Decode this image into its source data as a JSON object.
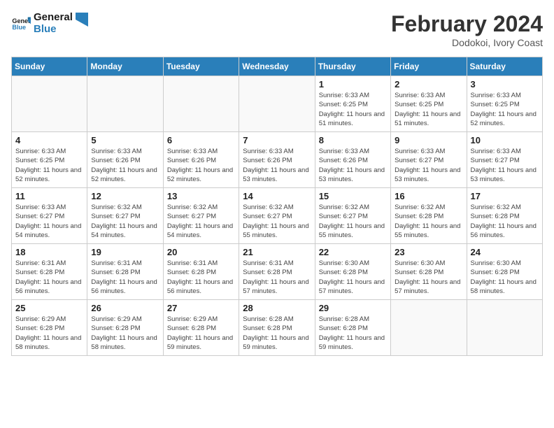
{
  "header": {
    "logo_line1": "General",
    "logo_line2": "Blue",
    "title": "February 2024",
    "subtitle": "Dodokoi, Ivory Coast"
  },
  "weekdays": [
    "Sunday",
    "Monday",
    "Tuesday",
    "Wednesday",
    "Thursday",
    "Friday",
    "Saturday"
  ],
  "weeks": [
    [
      {
        "day": "",
        "info": ""
      },
      {
        "day": "",
        "info": ""
      },
      {
        "day": "",
        "info": ""
      },
      {
        "day": "",
        "info": ""
      },
      {
        "day": "1",
        "info": "Sunrise: 6:33 AM\nSunset: 6:25 PM\nDaylight: 11 hours and 51 minutes."
      },
      {
        "day": "2",
        "info": "Sunrise: 6:33 AM\nSunset: 6:25 PM\nDaylight: 11 hours and 51 minutes."
      },
      {
        "day": "3",
        "info": "Sunrise: 6:33 AM\nSunset: 6:25 PM\nDaylight: 11 hours and 52 minutes."
      }
    ],
    [
      {
        "day": "4",
        "info": "Sunrise: 6:33 AM\nSunset: 6:25 PM\nDaylight: 11 hours and 52 minutes."
      },
      {
        "day": "5",
        "info": "Sunrise: 6:33 AM\nSunset: 6:26 PM\nDaylight: 11 hours and 52 minutes."
      },
      {
        "day": "6",
        "info": "Sunrise: 6:33 AM\nSunset: 6:26 PM\nDaylight: 11 hours and 52 minutes."
      },
      {
        "day": "7",
        "info": "Sunrise: 6:33 AM\nSunset: 6:26 PM\nDaylight: 11 hours and 53 minutes."
      },
      {
        "day": "8",
        "info": "Sunrise: 6:33 AM\nSunset: 6:26 PM\nDaylight: 11 hours and 53 minutes."
      },
      {
        "day": "9",
        "info": "Sunrise: 6:33 AM\nSunset: 6:27 PM\nDaylight: 11 hours and 53 minutes."
      },
      {
        "day": "10",
        "info": "Sunrise: 6:33 AM\nSunset: 6:27 PM\nDaylight: 11 hours and 53 minutes."
      }
    ],
    [
      {
        "day": "11",
        "info": "Sunrise: 6:33 AM\nSunset: 6:27 PM\nDaylight: 11 hours and 54 minutes."
      },
      {
        "day": "12",
        "info": "Sunrise: 6:32 AM\nSunset: 6:27 PM\nDaylight: 11 hours and 54 minutes."
      },
      {
        "day": "13",
        "info": "Sunrise: 6:32 AM\nSunset: 6:27 PM\nDaylight: 11 hours and 54 minutes."
      },
      {
        "day": "14",
        "info": "Sunrise: 6:32 AM\nSunset: 6:27 PM\nDaylight: 11 hours and 55 minutes."
      },
      {
        "day": "15",
        "info": "Sunrise: 6:32 AM\nSunset: 6:27 PM\nDaylight: 11 hours and 55 minutes."
      },
      {
        "day": "16",
        "info": "Sunrise: 6:32 AM\nSunset: 6:28 PM\nDaylight: 11 hours and 55 minutes."
      },
      {
        "day": "17",
        "info": "Sunrise: 6:32 AM\nSunset: 6:28 PM\nDaylight: 11 hours and 56 minutes."
      }
    ],
    [
      {
        "day": "18",
        "info": "Sunrise: 6:31 AM\nSunset: 6:28 PM\nDaylight: 11 hours and 56 minutes."
      },
      {
        "day": "19",
        "info": "Sunrise: 6:31 AM\nSunset: 6:28 PM\nDaylight: 11 hours and 56 minutes."
      },
      {
        "day": "20",
        "info": "Sunrise: 6:31 AM\nSunset: 6:28 PM\nDaylight: 11 hours and 56 minutes."
      },
      {
        "day": "21",
        "info": "Sunrise: 6:31 AM\nSunset: 6:28 PM\nDaylight: 11 hours and 57 minutes."
      },
      {
        "day": "22",
        "info": "Sunrise: 6:30 AM\nSunset: 6:28 PM\nDaylight: 11 hours and 57 minutes."
      },
      {
        "day": "23",
        "info": "Sunrise: 6:30 AM\nSunset: 6:28 PM\nDaylight: 11 hours and 57 minutes."
      },
      {
        "day": "24",
        "info": "Sunrise: 6:30 AM\nSunset: 6:28 PM\nDaylight: 11 hours and 58 minutes."
      }
    ],
    [
      {
        "day": "25",
        "info": "Sunrise: 6:29 AM\nSunset: 6:28 PM\nDaylight: 11 hours and 58 minutes."
      },
      {
        "day": "26",
        "info": "Sunrise: 6:29 AM\nSunset: 6:28 PM\nDaylight: 11 hours and 58 minutes."
      },
      {
        "day": "27",
        "info": "Sunrise: 6:29 AM\nSunset: 6:28 PM\nDaylight: 11 hours and 59 minutes."
      },
      {
        "day": "28",
        "info": "Sunrise: 6:28 AM\nSunset: 6:28 PM\nDaylight: 11 hours and 59 minutes."
      },
      {
        "day": "29",
        "info": "Sunrise: 6:28 AM\nSunset: 6:28 PM\nDaylight: 11 hours and 59 minutes."
      },
      {
        "day": "",
        "info": ""
      },
      {
        "day": "",
        "info": ""
      }
    ]
  ]
}
